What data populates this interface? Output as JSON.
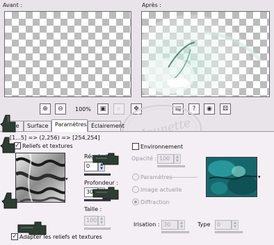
{
  "previews": {
    "before_label": "Avant :",
    "after_label": "Après :"
  },
  "toolbar": {
    "zoom_value": "100%"
  },
  "tabs": [
    {
      "label": "...e"
    },
    {
      "label": "Surface"
    },
    {
      "label": "Paramètres"
    },
    {
      "label": "Éclairement"
    }
  ],
  "left": {
    "coord_text": "[1...5] => (2,256) => [254,254]",
    "reliefs_checkbox": {
      "label": "Reliefs et textures",
      "checked": true
    },
    "regularite": {
      "label": "Régularité :",
      "value": "0"
    },
    "profondeur": {
      "label": "Profondeur :",
      "value": "30"
    },
    "taille": {
      "label": "Taille :",
      "value": "100"
    },
    "adapter_checkbox": {
      "label": "Adapter les reliefs et textures",
      "checked": true
    }
  },
  "right": {
    "environnement_checkbox": {
      "label": "Environnement",
      "checked": false
    },
    "opacite": {
      "label": "Opacité :",
      "value": "100"
    },
    "radio_parametres": "Paramètres",
    "radio_image_actuelle": "Image actuelle",
    "radio_diffraction": "Diffraction",
    "irisation": {
      "label": "Irisation :",
      "value": "30"
    },
    "type": {
      "label": "Type",
      "value": "0"
    }
  },
  "watermark": {
    "text": "Jounette"
  },
  "colors": {
    "window_bg": "#e9e3ea",
    "panel_bg": "#f3eff4",
    "hand_cursor": "#2e3d34",
    "env_texture": "#1c7f83"
  }
}
